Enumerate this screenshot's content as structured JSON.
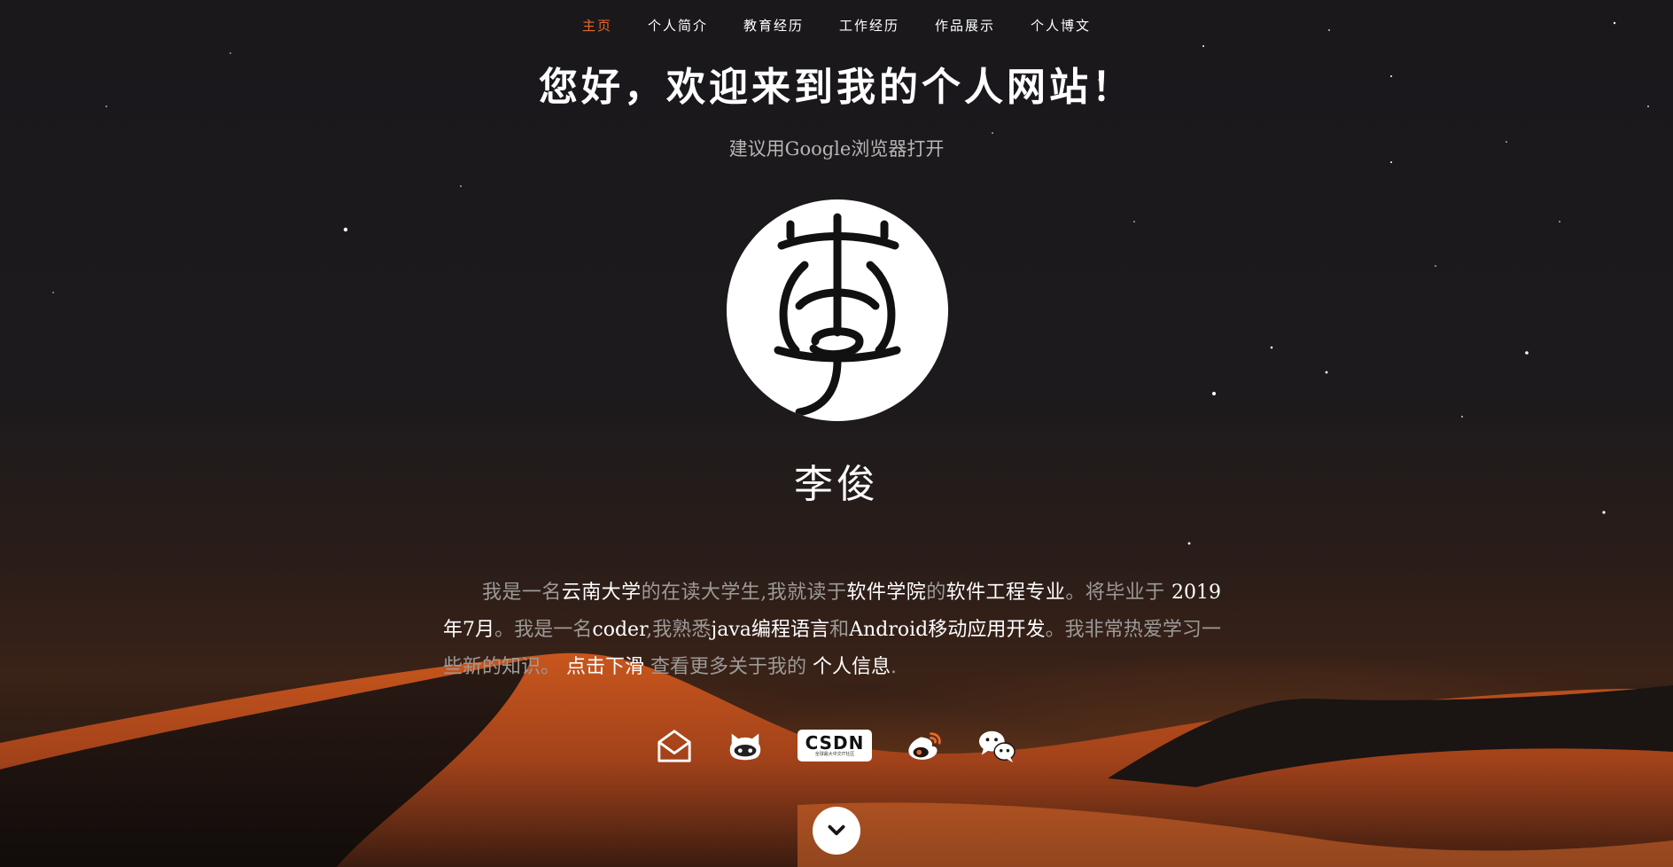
{
  "nav": {
    "items": [
      {
        "label": "主页",
        "active": true
      },
      {
        "label": "个人简介",
        "active": false
      },
      {
        "label": "教育经历",
        "active": false
      },
      {
        "label": "工作经历",
        "active": false
      },
      {
        "label": "作品展示",
        "active": false
      },
      {
        "label": "个人博文",
        "active": false
      }
    ]
  },
  "hero": {
    "title": "您好，欢迎来到我的个人网站！",
    "subtitle": "建议用Google浏览器打开",
    "avatar_icon": "seal-li-character-icon",
    "name": "李俊"
  },
  "intro": {
    "p1": "我是一名",
    "h1": "云南大学",
    "p2": "的在读大学生,我就读于",
    "h2": "软件学院",
    "p3": "的",
    "h3": "软件工程专业",
    "p4": "。将毕业于 ",
    "h4": "2019年7月",
    "p5": "。我是一名",
    "h5": "coder",
    "p6": ",我熟悉",
    "h6": "java编程语言",
    "p7": "和",
    "h7": "Android",
    "h8": "移动应用开发",
    "p8": "。我非常热爱学习一些新的知识。 ",
    "h9": "点击下滑",
    "p9": " 查看更多关于我的 ",
    "h10": "个人信息",
    "p10": "."
  },
  "social": {
    "icons": [
      "mail-icon",
      "github-cat-icon",
      "csdn-icon",
      "weibo-icon",
      "wechat-icon"
    ],
    "csdn_text": "CSDN",
    "csdn_sub": "全球最大中文IT社区"
  },
  "scroll_icon": "chevron-down-icon",
  "colors": {
    "accent": "#e46a2a",
    "text": "#ffffff",
    "muted": "#9d9a98",
    "background": "#19171a"
  }
}
